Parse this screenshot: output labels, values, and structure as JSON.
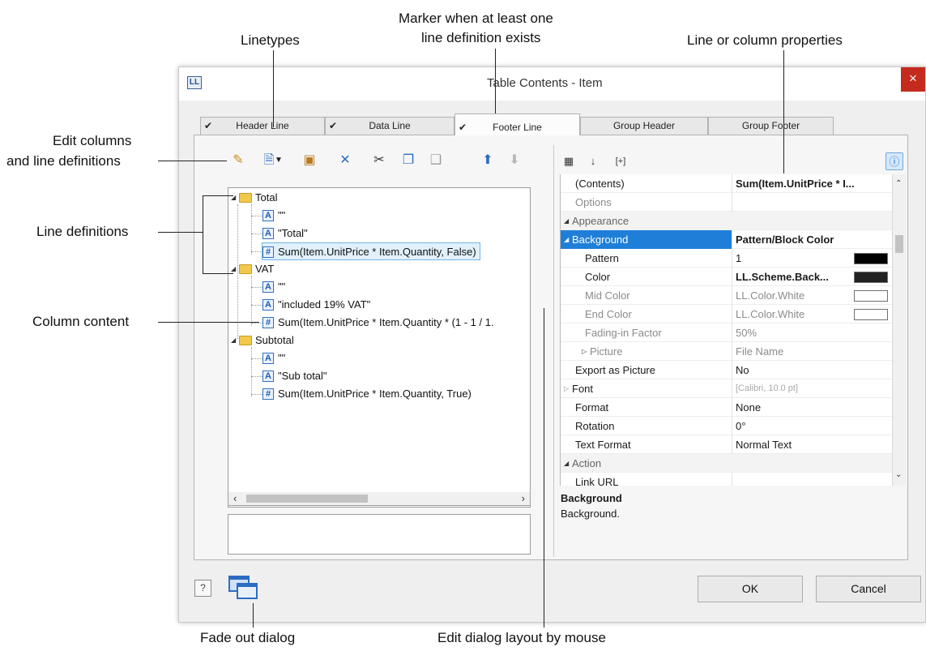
{
  "callouts": {
    "linetypes": "Linetypes",
    "marker_line1": "Marker when at least one",
    "marker_line2": "line definition exists",
    "line_props": "Line or column properties",
    "edit_columns_line1": "Edit columns",
    "edit_columns_line2": "and line definitions",
    "line_definitions": "Line definitions",
    "column_content": "Column content",
    "fade_out": "Fade out dialog",
    "edit_layout": "Edit dialog layout by mouse"
  },
  "dialog": {
    "title": "Table Contents - Item",
    "app_icon": "LL",
    "close": "×"
  },
  "tabs": [
    {
      "label": "Header Line",
      "checked": "✔"
    },
    {
      "label": "Data Line",
      "checked": "✔"
    },
    {
      "label": "Footer Line",
      "checked": "✔"
    },
    {
      "label": "Group Header",
      "checked": ""
    },
    {
      "label": "Group Footer",
      "checked": ""
    }
  ],
  "tree": {
    "groups": [
      {
        "name": "Total",
        "items": [
          {
            "icon": "A",
            "text": "\"\""
          },
          {
            "icon": "A",
            "text": "\"Total\""
          },
          {
            "icon": "#",
            "text": "Sum(Item.UnitPrice * Item.Quantity, False)"
          }
        ]
      },
      {
        "name": "VAT",
        "items": [
          {
            "icon": "A",
            "text": "\"\""
          },
          {
            "icon": "A",
            "text": "\"included 19% VAT\""
          },
          {
            "icon": "#",
            "text": "Sum(Item.UnitPrice * Item.Quantity * (1 - 1 / 1."
          }
        ]
      },
      {
        "name": "Subtotal",
        "items": [
          {
            "icon": "A",
            "text": "\"\""
          },
          {
            "icon": "A",
            "text": "\"Sub total\""
          },
          {
            "icon": "#",
            "text": "Sum(Item.UnitPrice * Item.Quantity, True)"
          }
        ]
      }
    ]
  },
  "properties": {
    "contents": {
      "name": "(Contents)",
      "value": "Sum(Item.UnitPrice * I..."
    },
    "options": {
      "name": "Options",
      "value": ""
    },
    "appearance": "Appearance",
    "background": {
      "name": "Background",
      "value": "Pattern/Block Color"
    },
    "pattern": {
      "name": "Pattern",
      "value": "1"
    },
    "color": {
      "name": "Color",
      "value": "LL.Scheme.Back..."
    },
    "mid_color": {
      "name": "Mid Color",
      "value": "LL.Color.White"
    },
    "end_color": {
      "name": "End Color",
      "value": "LL.Color.White"
    },
    "fading": {
      "name": "Fading-in Factor",
      "value": "50%"
    },
    "picture": {
      "name": "Picture",
      "value": "File Name"
    },
    "export_picture": {
      "name": "Export as Picture",
      "value": "No"
    },
    "font": {
      "name": "Font",
      "value": "[Calibri, 10.0 pt]"
    },
    "format": {
      "name": "Format",
      "value": "None"
    },
    "rotation": {
      "name": "Rotation",
      "value": "0°"
    },
    "text_format": {
      "name": "Text Format",
      "value": "Normal Text"
    },
    "action": "Action",
    "link_url": {
      "name": "Link URL",
      "value": ""
    }
  },
  "help": {
    "title": "Background",
    "text": "Background."
  },
  "buttons": {
    "ok": "OK",
    "cancel": "Cancel",
    "help_icon": "?"
  },
  "colors": {
    "selection_blue": "#1f7fd8",
    "tree_selection": "#e1f0fb",
    "close_red": "#c42b1c",
    "swatch_pattern": "#000000",
    "swatch_color": "#222222",
    "swatch_white": "#ffffff"
  }
}
